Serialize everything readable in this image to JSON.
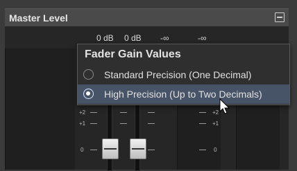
{
  "panel": {
    "title": "Master Level",
    "collapse_icon": "collapse-icon"
  },
  "readouts": [
    "0 dB",
    "0 dB",
    "-∞",
    "-∞"
  ],
  "scale_labels": {
    "plus2": "+2",
    "plus1": "+1",
    "zero": "0"
  },
  "menu": {
    "title": "Fader Gain Values",
    "options": [
      {
        "label": "Standard Precision (One Decimal)",
        "checked": false
      },
      {
        "label": "High Precision (Up to Two Decimals)",
        "checked": true
      }
    ]
  },
  "colors": {
    "selected_bg": "#475366",
    "popup_bg": "#2f2f2f"
  }
}
